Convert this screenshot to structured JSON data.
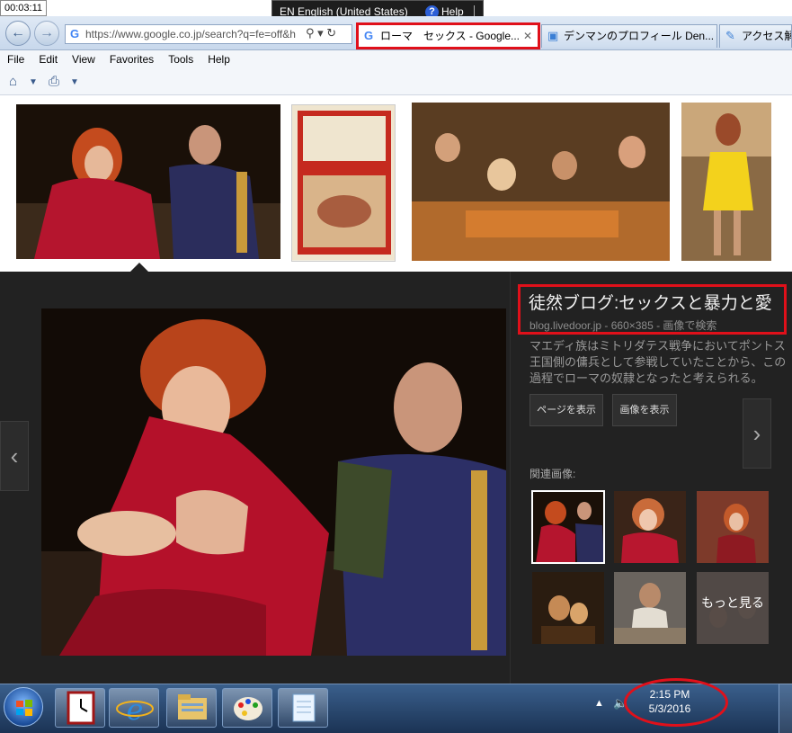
{
  "recorder": {
    "time": "00:03:11"
  },
  "language_bar": {
    "language": "EN English (United States)",
    "help": "Help"
  },
  "browser": {
    "url": "https://www.google.co.jp/search?q=fe=off&h",
    "tabs": [
      {
        "label": "ローマ　セックス - Google...",
        "active": true
      },
      {
        "label": "デンマンのプロフィール Den...",
        "active": false
      },
      {
        "label": "アクセス解",
        "active": false
      }
    ],
    "menu": [
      "File",
      "Edit",
      "View",
      "Favorites",
      "Tools",
      "Help"
    ],
    "icons": {
      "back": "back-arrow-icon",
      "forward": "forward-arrow-icon",
      "home": "home-icon",
      "print": "print-icon"
    }
  },
  "preview": {
    "title": "徒然ブログ:セックスと暴力と愛",
    "source": "blog.livedoor.jp - 660×385 - 画像で検索",
    "description": "マエディ族はミトリダテス戦争においてポントス王国側の傭兵として参戦していたことから、この過程でローマの奴隷となったと考えられる。",
    "visit_button": "ページを表示",
    "view_image_button": "画像を表示",
    "related_label": "関連画像:",
    "more_label": "もっと見る"
  },
  "taskbar": {
    "time": "2:15 PM",
    "date": "5/3/2016"
  },
  "colors": {
    "highlight": "#e0101a",
    "panel_bg": "#222222",
    "taskbar": "#1b3354"
  }
}
